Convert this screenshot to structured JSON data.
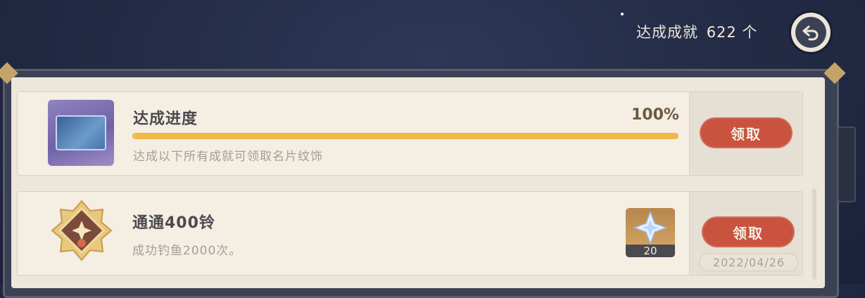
{
  "header": {
    "achieved_label": "达成成就",
    "achieved_count": "622",
    "achieved_unit": "个",
    "back_icon": "back-arrow-icon"
  },
  "progress_card": {
    "title": "达成进度",
    "percent_text": "100%",
    "progress": 1.0,
    "description": "达成以下所有成就可领取名片纹饰",
    "claim_label": "领取",
    "icon": "namecard-icon"
  },
  "achievements": [
    {
      "title": "通通400铃",
      "description": "成功钓鱼2000次。",
      "reward_icon": "primogem-icon",
      "reward_qty": "20",
      "claim_label": "领取",
      "date": "2022/04/26",
      "medal_icon": "achievement-medal-icon"
    }
  ],
  "colors": {
    "background": "#242c47",
    "panel": "#ede6da",
    "accent_progress": "#f0b94a",
    "claim_button": "#c9533f"
  }
}
